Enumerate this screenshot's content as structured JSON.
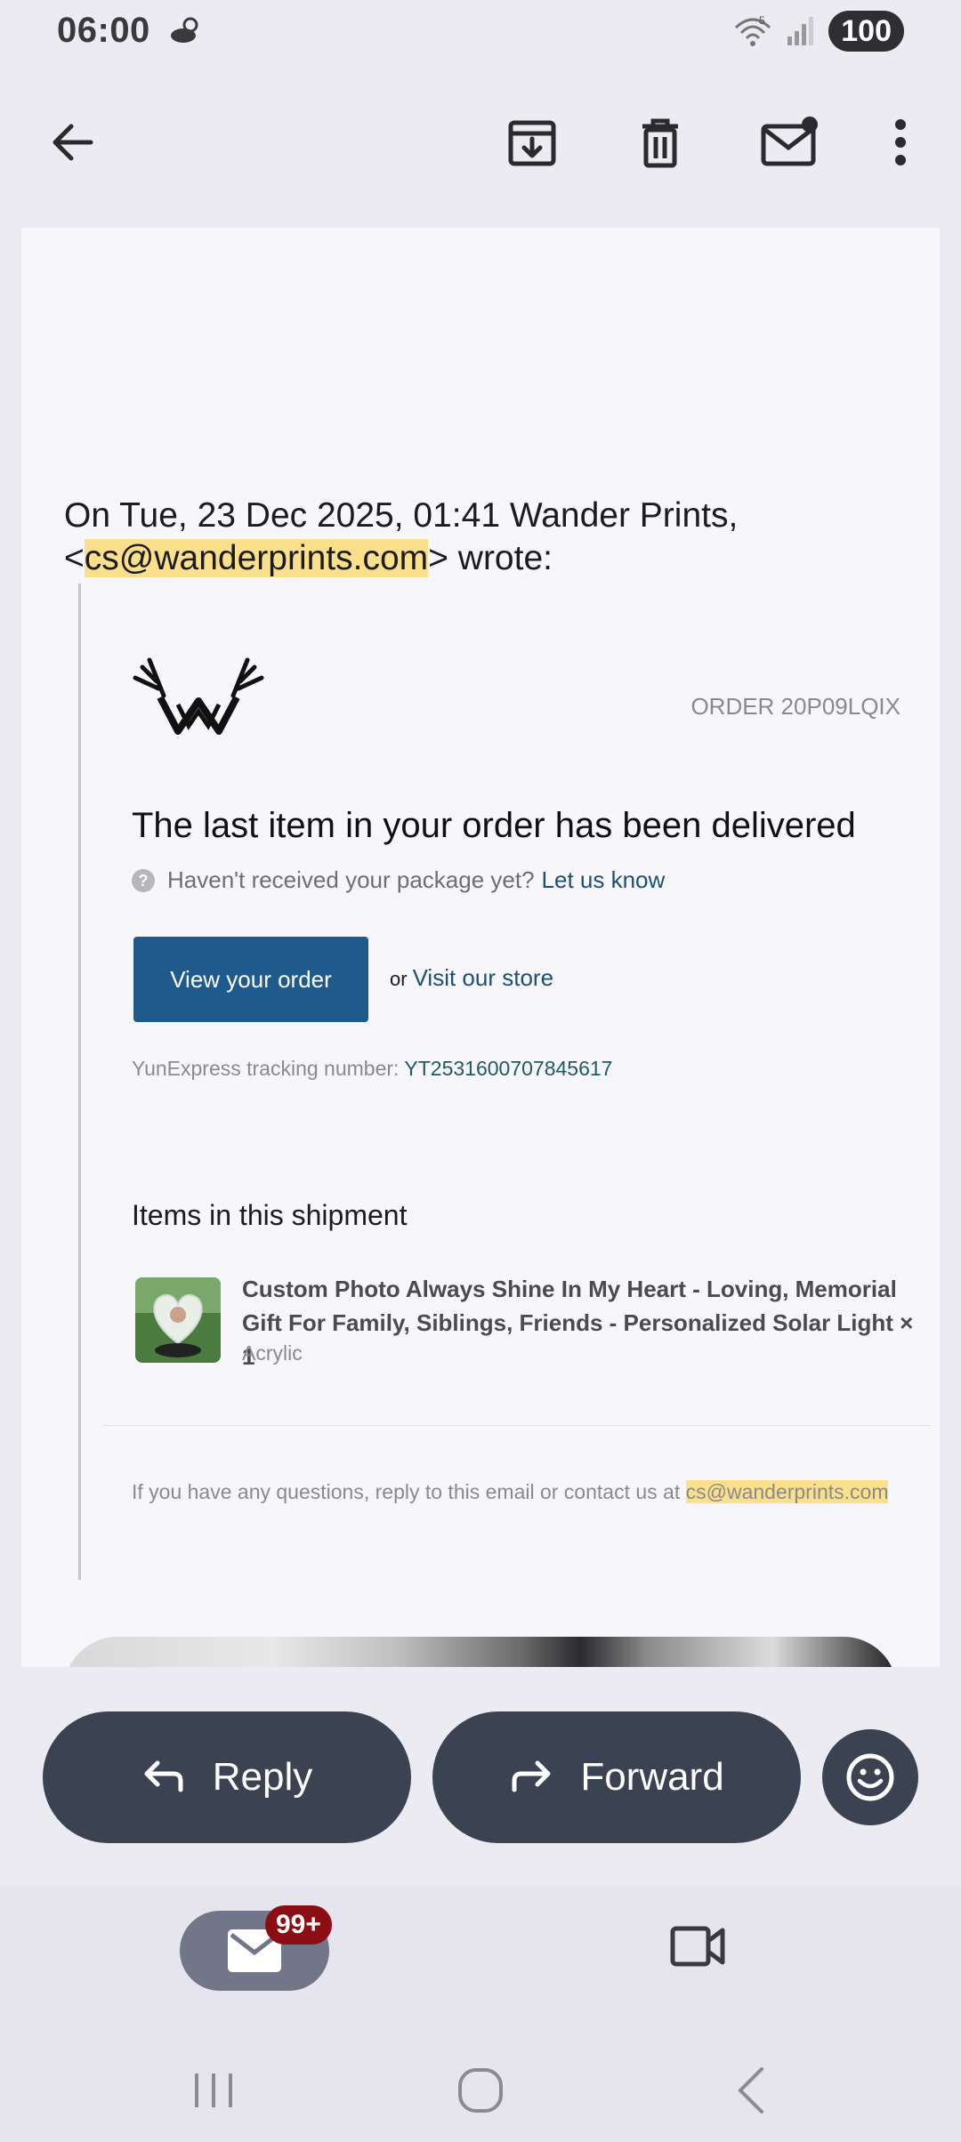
{
  "status_bar": {
    "time": "06:00",
    "battery": "100",
    "network_sup": "5"
  },
  "toolbar": {
    "back": "back",
    "archive": "archive",
    "delete": "delete",
    "mark_unread": "mark-unread",
    "more": "more"
  },
  "email": {
    "quote_intro": "On Tue, 23 Dec 2025, 01:41 Wander Prints,",
    "quote_lt": "<",
    "quote_email": "cs@wanderprints.com",
    "quote_tail": "> wrote:",
    "logo_text": "WANDER PRINTS",
    "order_number": "ORDER 20P09LQIX",
    "title": "The last item in your order has been delivered",
    "not_received_text": "Haven't received your package yet?",
    "let_us_know": "Let us know",
    "view_order_button": "View your order",
    "or": "or",
    "visit_store": "Visit our store",
    "tracking_label": "YunExpress tracking number:",
    "tracking_number": "YT2531600707845617",
    "items_heading": "Items in this shipment",
    "item": {
      "name": "Custom Photo Always Shine In My Heart - Loving, Memorial Gift For Family, Siblings, Friends - Personalized Solar Light × 1",
      "variant": "Acrylic"
    },
    "contact_text": "If you have any questions, reply to this email or contact us at",
    "contact_email": "cs@wanderprints.com"
  },
  "actions": {
    "reply": "Reply",
    "forward": "Forward"
  },
  "bottom_nav": {
    "mail_badge": "99+"
  },
  "colors": {
    "accent_button": "#1f5a8d",
    "pill": "#3b4252",
    "badge": "#8b0e14",
    "highlight": "#fbe08c"
  }
}
